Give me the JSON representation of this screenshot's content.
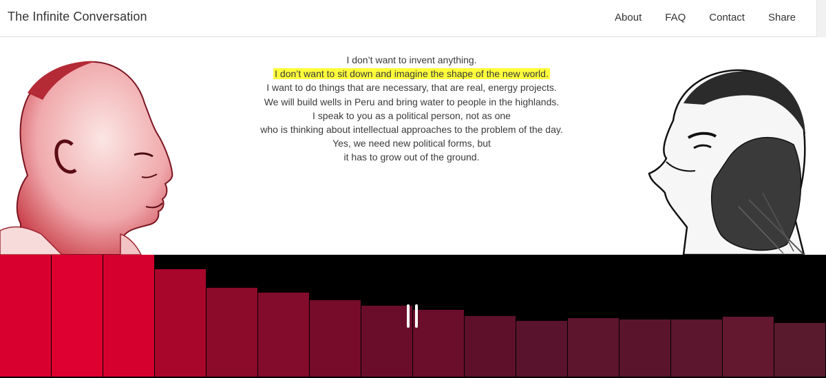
{
  "app": {
    "title": "The Infinite Conversation"
  },
  "nav": {
    "items": [
      "About",
      "FAQ",
      "Contact",
      "Share"
    ]
  },
  "transcript": {
    "lines": [
      {
        "text": "I don’t want to invent anything.",
        "highlighted": false
      },
      {
        "text": "I don’t want to sit down and imagine the shape of the new world.",
        "highlighted": true
      },
      {
        "text": "I want to do things that are necessary, that are real, energy projects.",
        "highlighted": false
      },
      {
        "text": "We will build wells in Peru and bring water to people in the highlands.",
        "highlighted": false
      },
      {
        "text": "I speak to you as a political person, not as one",
        "highlighted": false
      },
      {
        "text": "who is thinking about intellectual approaches to the problem of the day.",
        "highlighted": false
      },
      {
        "text": "Yes, we need new political forms, but",
        "highlighted": false
      },
      {
        "text": "it has to grow out of the ground.",
        "highlighted": false
      }
    ]
  },
  "portraits": {
    "left": {
      "icon": "speaker-portrait-left",
      "tint": "#c8323c"
    },
    "right": {
      "icon": "speaker-portrait-right",
      "tint": "#222222"
    }
  },
  "visualizer": {
    "levels": [
      1.0,
      1.0,
      1.0,
      0.88,
      0.73,
      0.69,
      0.63,
      0.58,
      0.55,
      0.5,
      0.46,
      0.48,
      0.47,
      0.47,
      0.49,
      0.44
    ],
    "colors": [
      "#d8002f",
      "#de0030",
      "#d6002f",
      "#a9062c",
      "#8c0a2a",
      "#830b2b",
      "#760c2a",
      "#6a0d2b",
      "#6a0e2c",
      "#5e102b",
      "#5a132c",
      "#5c152d",
      "#5a152c",
      "#5c162d",
      "#63182f",
      "#581a2c"
    ]
  },
  "player": {
    "state": "playing",
    "control_icon": "pause-icon"
  },
  "colors": {
    "highlight": "#ffff3b",
    "text": "#3a3a3a",
    "visualizer_bg": "#000000"
  }
}
